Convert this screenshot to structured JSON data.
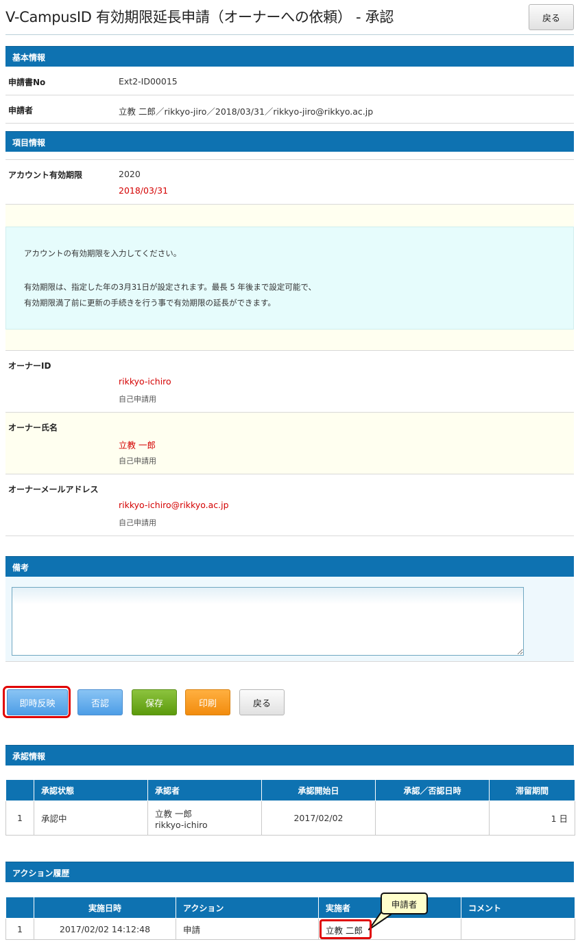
{
  "header": {
    "title": "V-CampusID 有効期限延長申請（オーナーへの依頼） - 承認",
    "back_label": "戻る"
  },
  "basic_info": {
    "section_title": "基本情報",
    "app_no_label": "申請書No",
    "app_no_value": "Ext2-ID00015",
    "applicant_label": "申請者",
    "applicant_value": "立教 二郎／rikkyo-jiro／2018/03/31／rikkyo-jiro@rikkyo.ac.jp"
  },
  "item_info": {
    "section_title": "項目情報",
    "expiry_label": "アカウント有効期限",
    "expiry_year": "2020",
    "expiry_current": "2018/03/31",
    "notice_line1": "アカウントの有効期限を入力してください。",
    "notice_line2": "有効期限は、指定した年の3月31日が設定されます。最長 5 年後まで設定可能で、",
    "notice_line3": "有効期限満了前に更新の手続きを行う事で有効期限の延長ができます。",
    "owner_id_label": "オーナーID",
    "owner_id_value": "rikkyo-ichiro",
    "owner_id_note": "自己申請用",
    "owner_name_label": "オーナー氏名",
    "owner_name_value": "立教 一郎",
    "owner_name_note": "自己申請用",
    "owner_mail_label": "オーナーメールアドレス",
    "owner_mail_value": "rikkyo-ichiro@rikkyo.ac.jp",
    "owner_mail_note": "自己申請用"
  },
  "remarks": {
    "section_title": "備考",
    "text": ""
  },
  "actions": {
    "apply_label": "即時反映",
    "reject_label": "否認",
    "save_label": "保存",
    "print_label": "印刷",
    "back_label": "戻る"
  },
  "approval": {
    "section_title": "承認情報",
    "columns": [
      "",
      "承認状態",
      "承認者",
      "承認開始日",
      "承認／否認日時",
      "滞留期間"
    ],
    "row": {
      "no": "1",
      "status": "承認中",
      "approver_name": "立教 一郎",
      "approver_id": "rikkyo-ichiro",
      "start_date": "2017/02/02",
      "decided_at": "",
      "stay": "1 日"
    }
  },
  "history": {
    "section_title": "アクション履歴",
    "columns": [
      "",
      "実施日時",
      "アクション",
      "実施者",
      "コメント"
    ],
    "row": {
      "no": "1",
      "datetime": "2017/02/02 14:12:48",
      "action": "申請",
      "actor": "立教 二郎",
      "comment": ""
    }
  },
  "annotation": {
    "callout_text": "申請者",
    "highlight_color": "#e00000"
  },
  "colors": {
    "header_bar": "#0e72b1",
    "red_text": "#d40000"
  }
}
